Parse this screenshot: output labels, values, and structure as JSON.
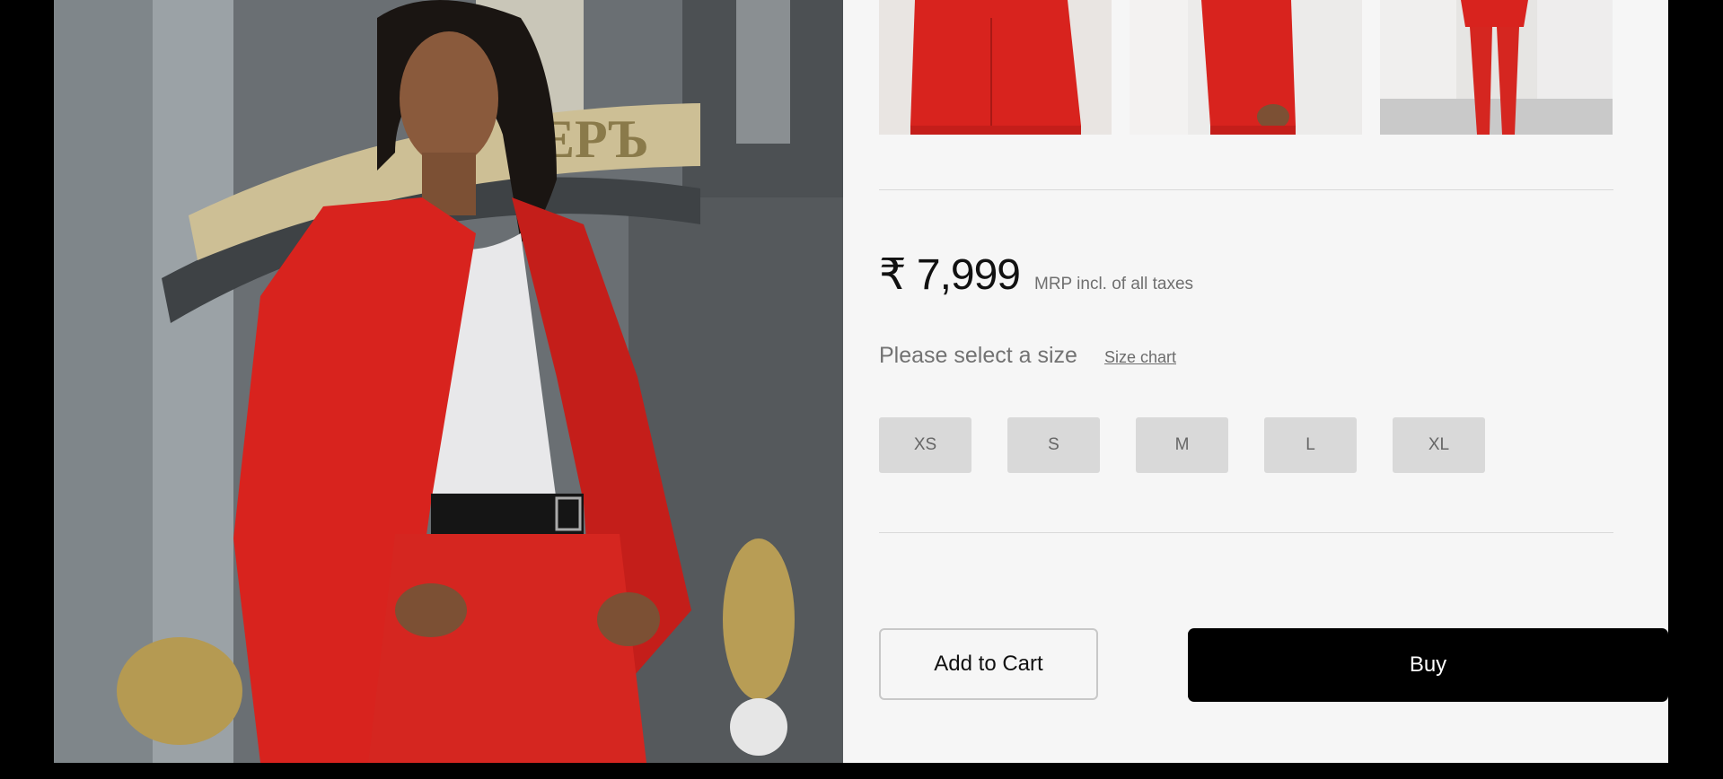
{
  "product": {
    "hero_image": "model-in-red-suit-photo",
    "thumbnails": [
      {
        "name": "red-blazer-back-view"
      },
      {
        "name": "red-blazer-side-view"
      },
      {
        "name": "red-suit-full-view"
      }
    ],
    "price": "₹ 7,999",
    "price_note": "MRP incl. of all taxes"
  },
  "size_selector": {
    "title": "Please select a size",
    "chart_link": "Size chart",
    "options": [
      "XS",
      "S",
      "M",
      "L",
      "XL"
    ]
  },
  "actions": {
    "add_to_cart": "Add to Cart",
    "buy": "Buy"
  },
  "colors": {
    "suit_red": "#d8231e",
    "background": "#f6f6f6",
    "size_button": "#d9d9d9",
    "buy_button": "#000000"
  }
}
